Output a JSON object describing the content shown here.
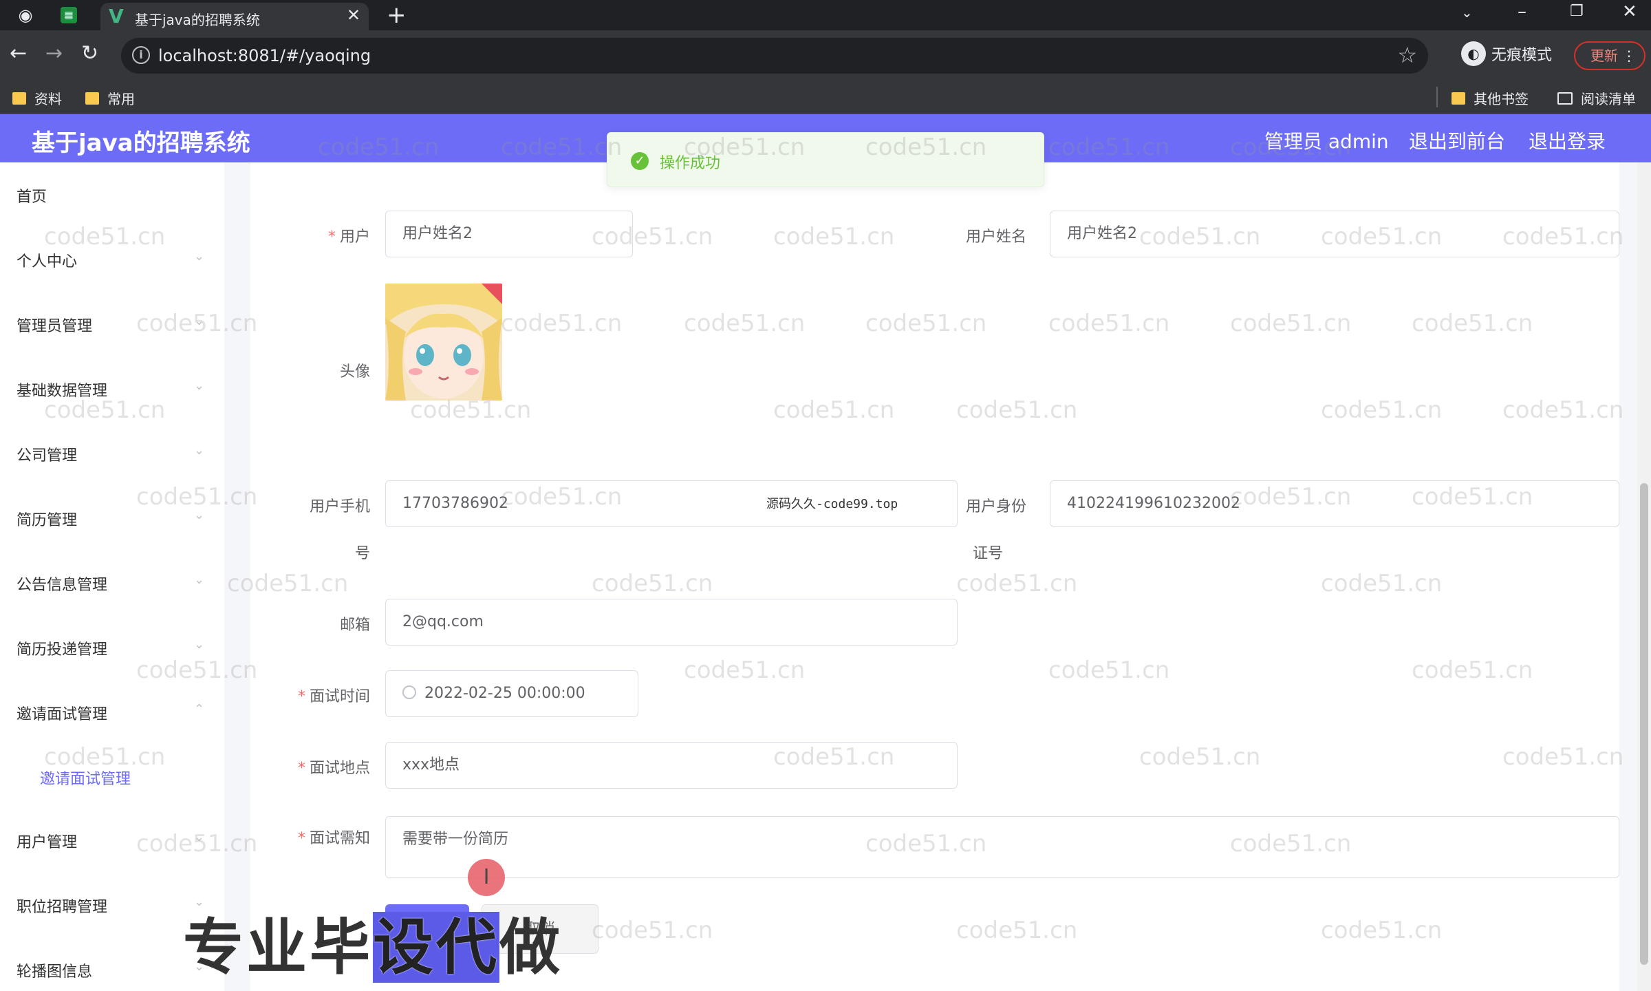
{
  "browser": {
    "tab_title": "基于java的招聘系统",
    "url": "localhost:8081/#/yaoqing",
    "incognito_label": "无痕模式",
    "update_label": "更新",
    "bookmarks": [
      "资料",
      "常用"
    ],
    "other_bookmarks": "其他书签",
    "reading_list": "阅读清单"
  },
  "app": {
    "title": "基于java的招聘系统",
    "admin_label": "管理员 admin",
    "to_front_label": "退出到前台",
    "logout_label": "退出登录"
  },
  "sidebar": {
    "items": [
      {
        "label": "首页"
      },
      {
        "label": "个人中心"
      },
      {
        "label": "管理员管理"
      },
      {
        "label": "基础数据管理"
      },
      {
        "label": "公司管理"
      },
      {
        "label": "简历管理"
      },
      {
        "label": "公告信息管理"
      },
      {
        "label": "简历投递管理"
      },
      {
        "label": "邀请面试管理"
      },
      {
        "label": "用户管理"
      },
      {
        "label": "职位招聘管理"
      },
      {
        "label": "轮播图信息"
      }
    ],
    "active_sub": "邀请面试管理"
  },
  "toast": {
    "message": "操作成功",
    "color": "#67c23a"
  },
  "form": {
    "user_label": "用户",
    "user_value": "用户姓名2",
    "user_name_label": "用户姓名",
    "user_name_value": "用户姓名2",
    "avatar_label": "头像",
    "phone_label_1": "用户手机",
    "phone_label_2": "号",
    "phone_value": "17703786902",
    "idcard_label_1": "用户身份",
    "idcard_label_2": "证号",
    "idcard_value": "410224199610232002",
    "email_label": "邮箱",
    "email_value": "2@qq.com",
    "time_label": "面试时间",
    "time_value": "2022-02-25 00:00:00",
    "place_label": "面试地点",
    "place_value": "xxx地点",
    "notice_label": "面试需知",
    "notice_value": "需要带一份简历",
    "cancel_label": "取消"
  },
  "overlay": {
    "banner_part1": "专业毕",
    "banner_part2": "设代",
    "banner_part3": "做",
    "source_note": "源码久久-code99.top",
    "watermark": "code51.cn"
  },
  "colors": {
    "primary": "#6d6cf6",
    "required": "#f56c6c",
    "success": "#67c23a"
  }
}
